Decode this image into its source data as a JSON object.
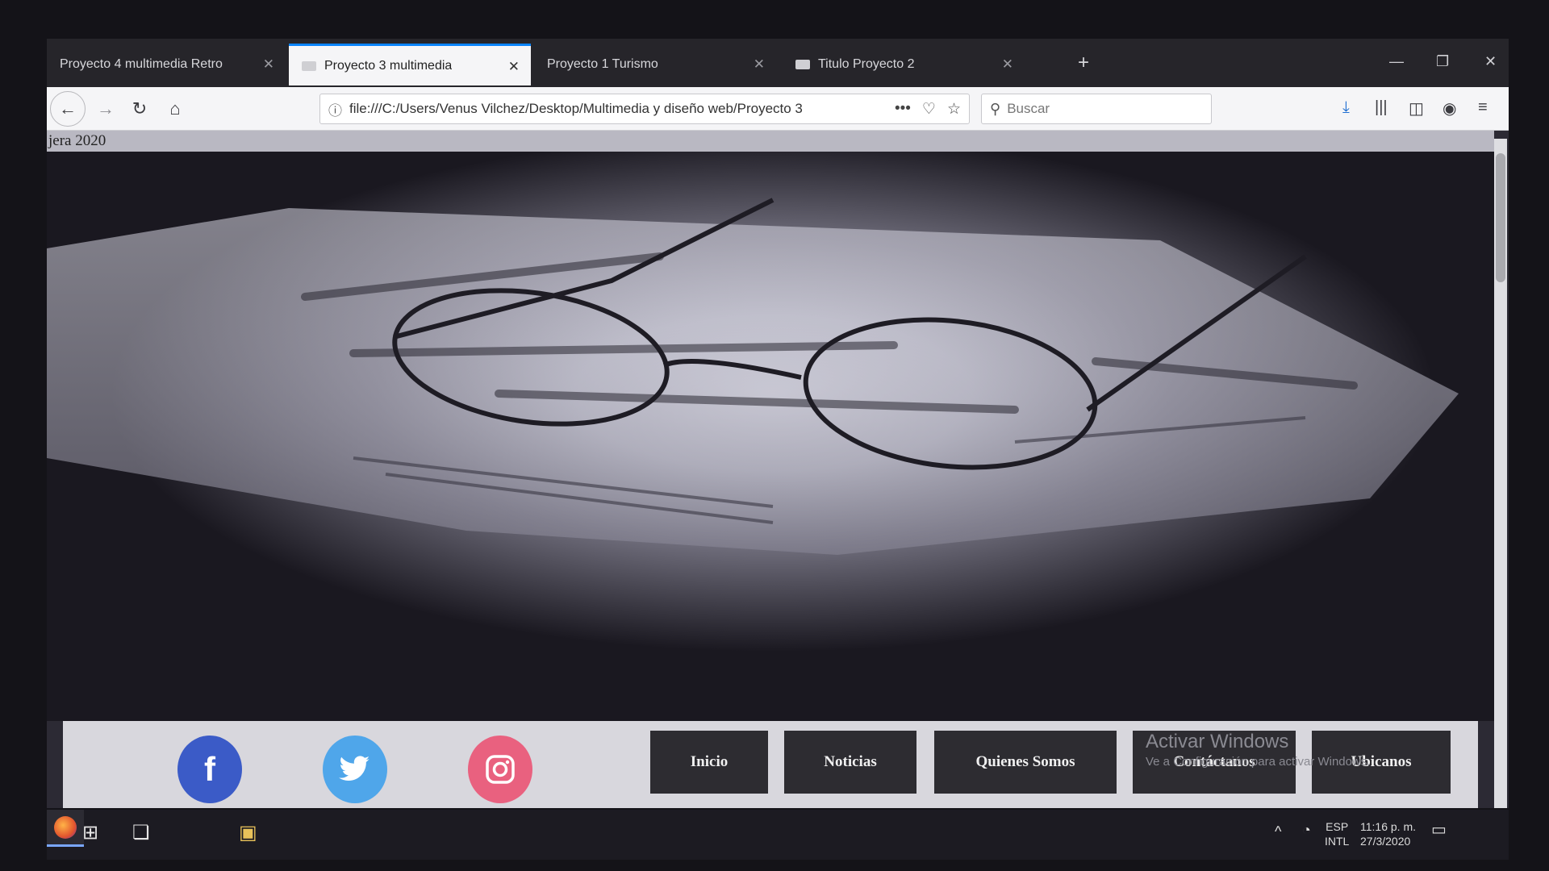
{
  "browser": {
    "tabs": [
      {
        "title": "Proyecto 4 multimedia Retro",
        "active": false
      },
      {
        "title": "Proyecto 3 multimedia",
        "active": true
      },
      {
        "title": "Proyecto 1 Turismo",
        "active": false
      },
      {
        "title": "Titulo Proyecto 2",
        "active": false
      }
    ],
    "url": "file:///C:/Users/Venus Vilchez/Desktop/Multimedia y diseño web/Proyecto 3",
    "search_placeholder": "Buscar"
  },
  "page": {
    "header_text": "jera 2020",
    "social": [
      "facebook-icon",
      "twitter-icon",
      "instagram-icon"
    ],
    "menu": [
      {
        "label": "Inicio"
      },
      {
        "label": "Noticias"
      },
      {
        "label": "Quienes Somos"
      },
      {
        "label": "Contáctanos"
      },
      {
        "label": "Ubicanos"
      }
    ]
  },
  "watermark": {
    "title": "Activar Windows",
    "subtitle": "Ve a Configuración para activar Windows."
  },
  "taskbar": {
    "lang_top": "ESP",
    "lang_bottom": "INTL",
    "time": "11:16 p. m.",
    "date": "27/3/2020"
  },
  "colors": {
    "accent": "#0a84ff",
    "facebook": "#3b5bc7",
    "twitter": "#4fa6ea",
    "instagram": "#e9617f",
    "menu_bg": "#2d2c31"
  }
}
